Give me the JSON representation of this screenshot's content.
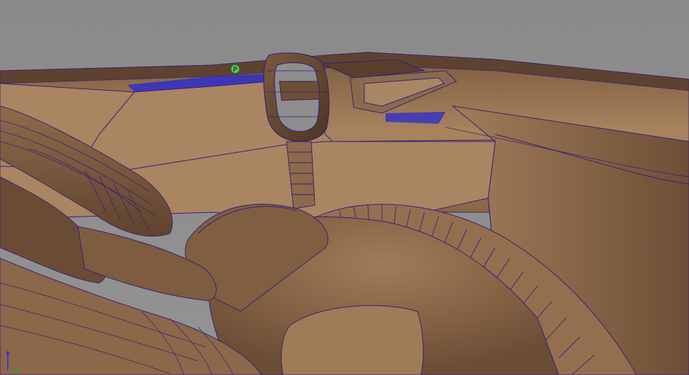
{
  "viewport": {
    "pivot_marker_label": "P",
    "background_color": "#8e8e8e",
    "model_color": "#9a7657",
    "wireframe_color": "#3b1f7a",
    "edge_highlight_color": "#1e2fd6",
    "axis_colors": {
      "up": "#2d2dff",
      "right": "#2c9c2c"
    }
  }
}
